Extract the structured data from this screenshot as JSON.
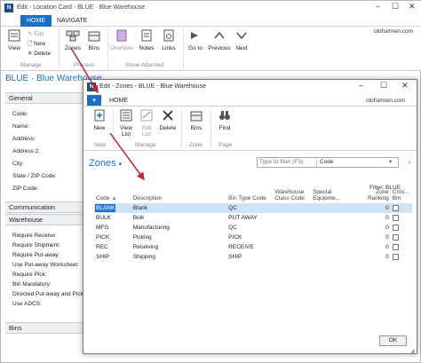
{
  "back": {
    "title": "Edit - Location Card - BLUE · Blue Warehouse",
    "tabs": [
      "HOME",
      "NAVIGATE"
    ],
    "ribbon": {
      "view": "View",
      "edit": "Edit",
      "new": "New",
      "delete": "Delete",
      "zones": "Zones",
      "bins": "Bins",
      "onenote": "OneNote",
      "notes": "Notes",
      "links": "Links",
      "go_to": "Go to",
      "previous": "Previous",
      "next": "Next",
      "groups": [
        "Manage",
        "Process",
        "Show Attached"
      ]
    },
    "user": "olofsimren.com",
    "heading": "BLUE · Blue Warehouse",
    "general_label": "General",
    "fields": [
      "Code:",
      "Name:",
      "Address:",
      "Address 2:",
      "City:",
      "State / ZIP Code:",
      "ZIP Code:"
    ],
    "communication_label": "Communication",
    "warehouse_label": "Warehouse",
    "warehouse_fields": [
      "Require Receive:",
      "Require Shipment:",
      "Require Put-away:",
      "Use Put-away Worksheet:",
      "Require Pick:",
      "Bin Mandatory:",
      "Directed Put-away and Pick:",
      "Use ADCS:"
    ],
    "bins_label": "Bins"
  },
  "dialog": {
    "title": "Edit - Zones - BLUE - Blue Warehouse",
    "tab_home": "HOME",
    "user": "olofsimren.com",
    "ribbon": {
      "new": "New",
      "view_list": "View List",
      "edit_list": "Edit List",
      "delete": "Delete",
      "bins": "Bins",
      "find": "Find",
      "groups": [
        "New",
        "Manage",
        "Zone",
        "Page"
      ]
    },
    "heading": "Zones",
    "filter_placeholder": "Type to filter (F3)",
    "filter_field": "Code",
    "filter_info": "Filter: BLUE",
    "columns": [
      "Code",
      "Description",
      "Bin Type Code",
      "Warehouse Class Code",
      "Special Equipme...",
      "Zone Ranking",
      "Cros... Bin"
    ],
    "rows": [
      {
        "code": "BLANK",
        "description": "Blank",
        "bin_type": "QC",
        "ranking": "0"
      },
      {
        "code": "BULK",
        "description": "Bulk",
        "bin_type": "PUT AWAY",
        "ranking": "0"
      },
      {
        "code": "MFG",
        "description": "Manufacturing",
        "bin_type": "QC",
        "ranking": "0"
      },
      {
        "code": "PICK",
        "description": "Picking",
        "bin_type": "PICK",
        "ranking": "0"
      },
      {
        "code": "REC",
        "description": "Receiving",
        "bin_type": "RECEIVE",
        "ranking": "0"
      },
      {
        "code": "SHIP",
        "description": "Shipping",
        "bin_type": "SHIP",
        "ranking": "0"
      }
    ],
    "ok_label": "OK"
  },
  "colors": {
    "accent": "#1b6ec2",
    "annotation_arrow": "#c0272d",
    "selected_row": "#cfe3f6"
  }
}
